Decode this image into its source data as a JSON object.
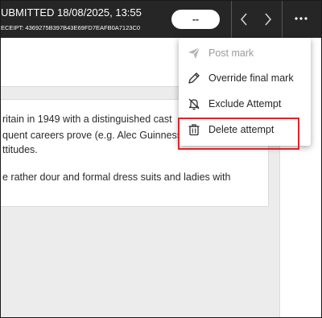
{
  "header": {
    "submitted_text": "UBMITTED 18/08/2025, 13:55",
    "receipt_text": "ECEIPT: 4369275B397B43E69FD7EAFB0A7123C0",
    "grade_value": "--"
  },
  "content": {
    "lines": [
      "ritain in 1949 with a distinguished cast",
      "quent careers prove (e.g. Alec Guinness",
      "ttitudes.",
      "e rather dour and formal dress suits and ladies with"
    ]
  },
  "menu": {
    "items": [
      {
        "label": "Post mark",
        "icon": "send-icon",
        "enabled": false
      },
      {
        "label": "Override final mark",
        "icon": "pencil-icon",
        "enabled": true
      },
      {
        "label": "Exclude Attempt",
        "icon": "bell-off-icon",
        "enabled": true
      },
      {
        "label": "Delete attempt",
        "icon": "trash-icon",
        "enabled": true
      }
    ]
  },
  "colors": {
    "header_bg": "#262626",
    "highlight": "#e0242c"
  }
}
